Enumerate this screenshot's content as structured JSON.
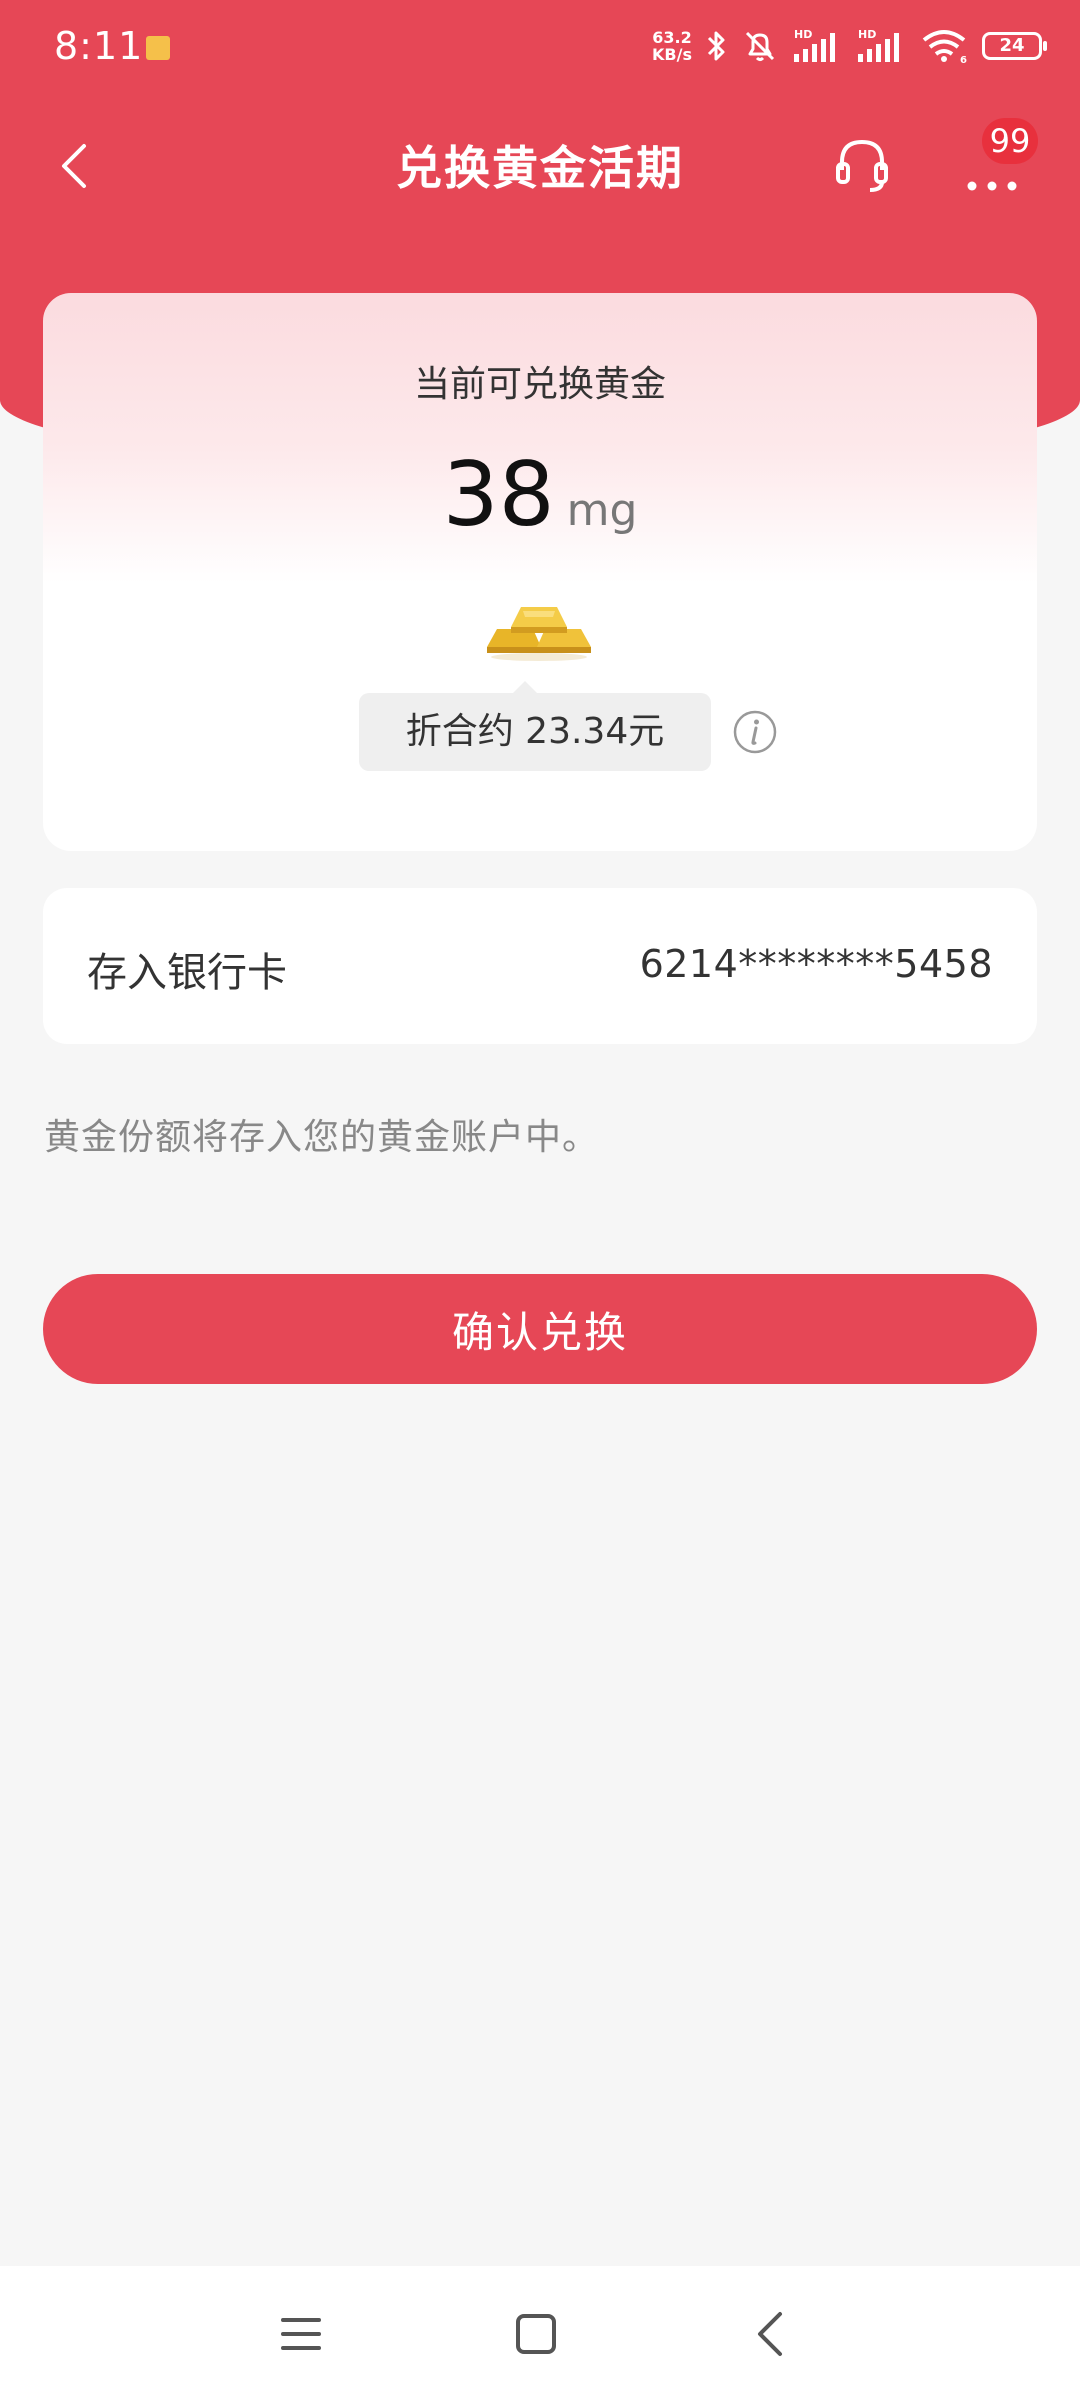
{
  "status_bar": {
    "time": "8:11",
    "speed_value": "63.2",
    "speed_unit": "KB/s",
    "signal_label_1": "HD",
    "signal_label_2": "HD",
    "wifi_label": "6",
    "battery": "24"
  },
  "nav": {
    "title": "兑换黄金活期",
    "badge_count": "99",
    "icons": [
      "back-arrow-icon",
      "headset-icon",
      "more-icon"
    ]
  },
  "gold_card": {
    "label": "当前可兑换黄金",
    "amount": "38",
    "unit": "mg",
    "approx_text": "折合约 23.34元",
    "icons": [
      "gold-bars-icon",
      "info-icon"
    ]
  },
  "deposit": {
    "label": "存入银行卡",
    "card_number": "6214********5458"
  },
  "note": "黄金份额将存入您的黄金账户中。",
  "confirm_button": "确认兑换",
  "system_nav": {
    "icons": [
      "menu-icon",
      "home-icon",
      "back-icon"
    ]
  },
  "colors": {
    "brand_red": "#e64756",
    "badge_red": "#e8303d",
    "page_bg": "#f6f6f6",
    "gold": "#e8b528"
  }
}
